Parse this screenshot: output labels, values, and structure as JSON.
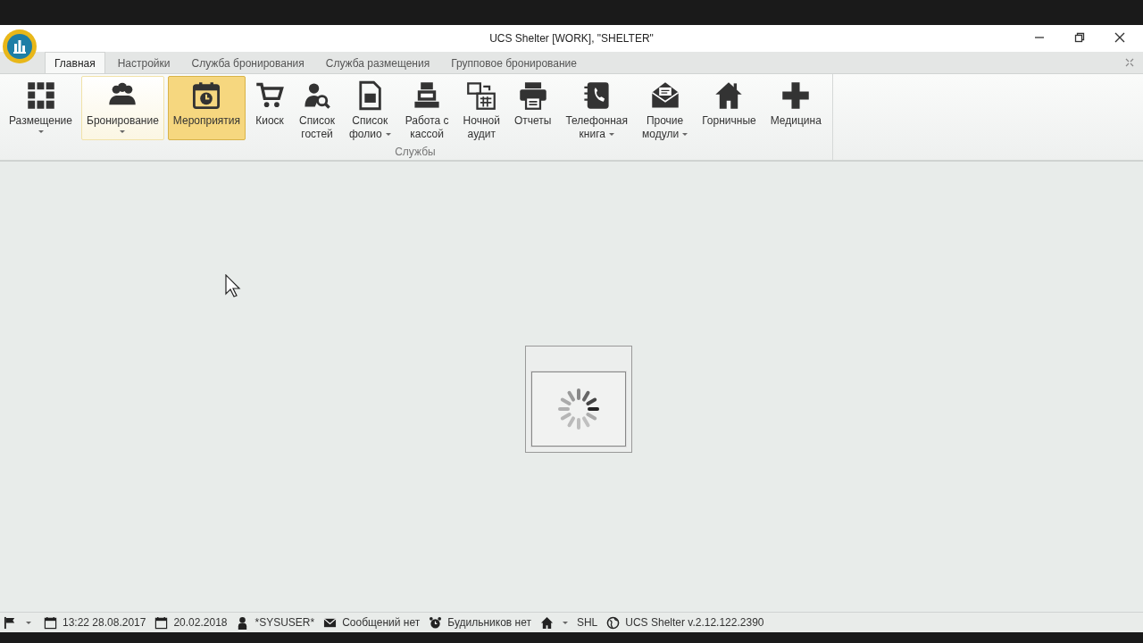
{
  "window": {
    "title": "UCS Shelter [WORK], \"SHELTER\""
  },
  "tabs": [
    {
      "label": "Главная",
      "selected": true
    },
    {
      "label": "Настройки",
      "selected": false
    },
    {
      "label": "Служба бронирования",
      "selected": false
    },
    {
      "label": "Служба размещения",
      "selected": false
    },
    {
      "label": "Групповое бронирование",
      "selected": false
    }
  ],
  "ribbon": {
    "group_label": "Службы",
    "items": [
      {
        "lines": [
          "Размещение"
        ],
        "dropdown": true,
        "selected": false,
        "hovered": false
      },
      {
        "lines": [
          "Бронирование"
        ],
        "dropdown": true,
        "selected": false,
        "hovered": true
      },
      {
        "lines": [
          "Мероприятия"
        ],
        "dropdown": false,
        "selected": true,
        "hovered": false
      },
      {
        "lines": [
          "Киоск"
        ],
        "dropdown": false,
        "selected": false,
        "hovered": false
      },
      {
        "lines": [
          "Список",
          "гостей"
        ],
        "dropdown": false,
        "selected": false,
        "hovered": false
      },
      {
        "lines": [
          "Список",
          "фолио"
        ],
        "dropdown": true,
        "selected": false,
        "hovered": false
      },
      {
        "lines": [
          "Работа с",
          "кассой"
        ],
        "dropdown": false,
        "selected": false,
        "hovered": false
      },
      {
        "lines": [
          "Ночной",
          "аудит"
        ],
        "dropdown": false,
        "selected": false,
        "hovered": false
      },
      {
        "lines": [
          "Отчеты"
        ],
        "dropdown": false,
        "selected": false,
        "hovered": false
      },
      {
        "lines": [
          "Телефонная",
          "книга"
        ],
        "dropdown": true,
        "selected": false,
        "hovered": false
      },
      {
        "lines": [
          "Прочие",
          "модули"
        ],
        "dropdown": true,
        "selected": false,
        "hovered": false
      },
      {
        "lines": [
          "Горничные"
        ],
        "dropdown": false,
        "selected": false,
        "hovered": false
      },
      {
        "lines": [
          "Медицина"
        ],
        "dropdown": false,
        "selected": false,
        "hovered": false
      }
    ]
  },
  "status_bar": [
    {
      "dropdown": true
    },
    {
      "text": "13:22 28.08.2017",
      "dropdown": false
    },
    {
      "text": "20.02.2018",
      "dropdown": false
    },
    {
      "text": "*SYSUSER*",
      "dropdown": false
    },
    {
      "text": "Сообщений нет",
      "dropdown": false
    },
    {
      "text": "Будильников нет",
      "dropdown": false
    },
    {
      "text": "SHL",
      "dropdown": true
    },
    {
      "text": "UCS Shelter v.2.12.122.2390",
      "dropdown": false
    }
  ]
}
